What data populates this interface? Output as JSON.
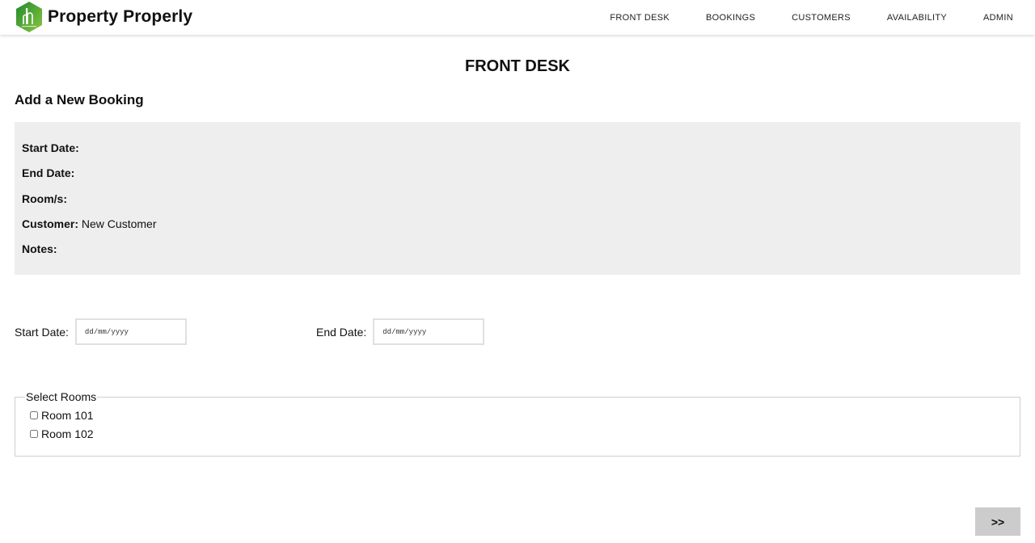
{
  "navbar": {
    "brand_name": "Property Properly",
    "logo_icon": "building-logo-icon",
    "links": [
      {
        "label": "FRONT DESK"
      },
      {
        "label": "BOOKINGS"
      },
      {
        "label": "CUSTOMERS"
      },
      {
        "label": "AVAILABILITY"
      },
      {
        "label": "ADMIN"
      }
    ]
  },
  "page": {
    "title": "FRONT DESK",
    "section_title": "Add a New Booking"
  },
  "summary": {
    "start_date": {
      "label": "Start Date:",
      "value": ""
    },
    "end_date": {
      "label": "End Date:",
      "value": ""
    },
    "rooms": {
      "label": "Room/s:",
      "value": ""
    },
    "customer": {
      "label": "Customer:",
      "value": "New Customer"
    },
    "notes": {
      "label": "Notes:",
      "value": ""
    }
  },
  "form": {
    "start_date": {
      "label": "Start Date:",
      "placeholder": "dd/mm/yyyy",
      "value": ""
    },
    "end_date": {
      "label": "End Date:",
      "placeholder": "dd/mm/yyyy",
      "value": ""
    },
    "rooms": {
      "legend": "Select Rooms",
      "options": [
        {
          "label": "Room 101",
          "checked": false
        },
        {
          "label": "Room 102",
          "checked": false
        }
      ]
    },
    "next_label": ">>"
  },
  "colors": {
    "logo_green_dark": "#1f8a2e",
    "logo_green_light": "#7cc242",
    "summary_bg": "#eeeeee",
    "button_bg": "#cccccc"
  }
}
